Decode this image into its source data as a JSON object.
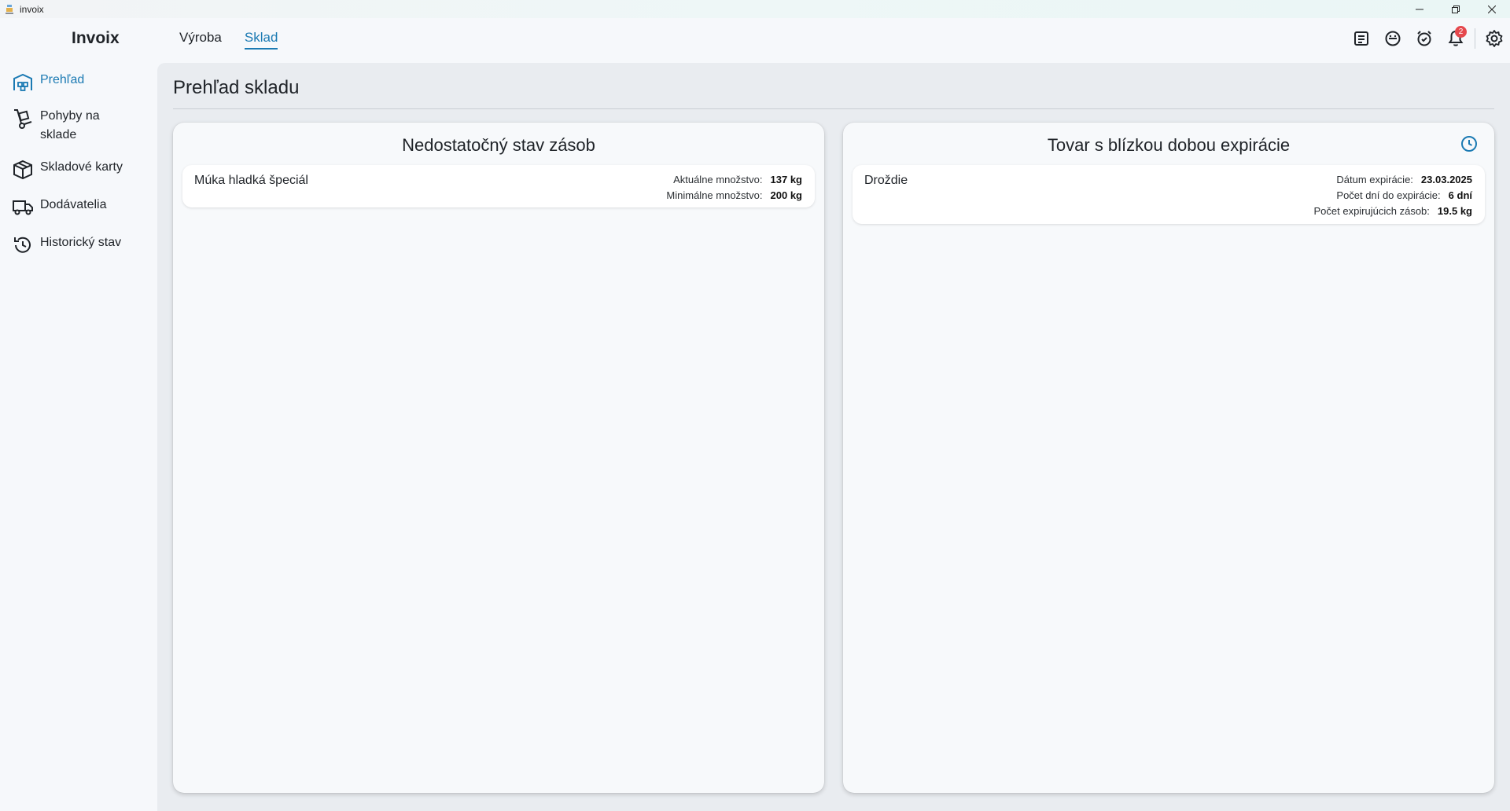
{
  "window": {
    "title": "invoix"
  },
  "app": {
    "brand": "Invoix"
  },
  "top_nav": {
    "tabs": [
      {
        "label": "Výroba",
        "active": false
      },
      {
        "label": "Sklad",
        "active": true
      }
    ]
  },
  "toolbar": {
    "icons": [
      "notes-icon",
      "chat-icon",
      "alarm-icon",
      "bell-icon",
      "gear-icon"
    ],
    "notifications_count": "2"
  },
  "sidebar": {
    "items": [
      {
        "label": "Prehľad",
        "icon": "warehouse-icon",
        "active": true
      },
      {
        "label": "Pohyby na sklade",
        "icon": "hand-truck-icon",
        "active": false
      },
      {
        "label": "Skladové karty",
        "icon": "box-icon",
        "active": false
      },
      {
        "label": "Dodávatelia",
        "icon": "truck-icon",
        "active": false
      },
      {
        "label": "Historický stav",
        "icon": "history-icon",
        "active": false
      }
    ]
  },
  "main": {
    "page_title": "Prehľad skladu",
    "low_stock": {
      "title": "Nedostatočný stav zásob",
      "items": [
        {
          "name": "Múka hladká špeciál",
          "current_label": "Aktuálne množstvo:",
          "current_value": "137 kg",
          "min_label": "Minimálne množstvo:",
          "min_value": "200 kg"
        }
      ]
    },
    "expiring": {
      "title": "Tovar s blízkou dobou expirácie",
      "header_icon": "clock-icon",
      "items": [
        {
          "name": "Droždie",
          "date_label": "Dátum expirácie:",
          "date_value": "23.03.2025",
          "days_label": "Počet dní do expirácie:",
          "days_value": "6 dní",
          "qty_label": "Počet expirujúcich zásob:",
          "qty_value": "19.5 kg"
        }
      ]
    }
  },
  "colors": {
    "accent": "#1b7ab3",
    "badge": "#e5484d",
    "background": "#f6f8fb",
    "main_background": "#e9ecf0",
    "card_background": "#f7f9fb"
  }
}
